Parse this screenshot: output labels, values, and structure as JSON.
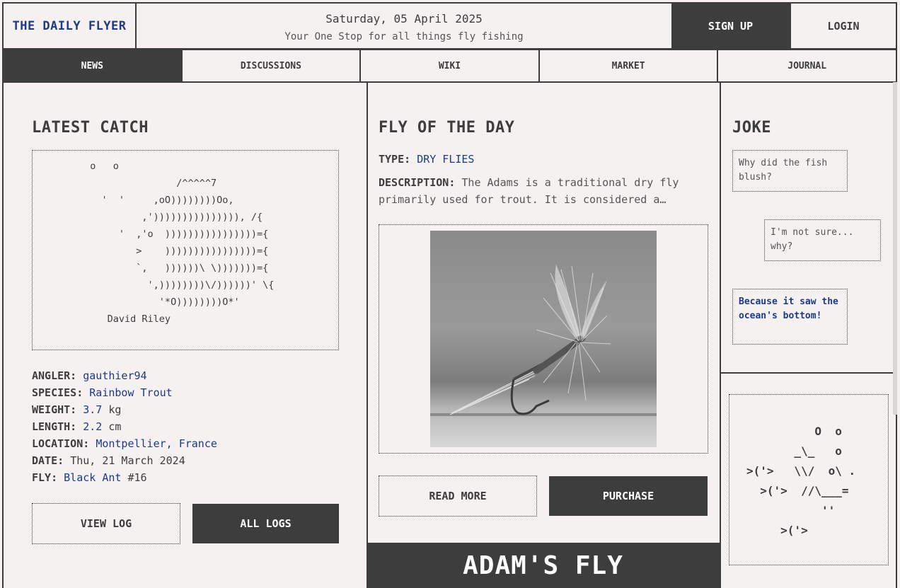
{
  "header": {
    "brand": "THE DAILY FLYER",
    "date": "Saturday, 05 April 2025",
    "tagline": "Your One Stop for all things fly fishing",
    "signup_label": "SIGN UP",
    "login_label": "LOGIN"
  },
  "nav": {
    "items": [
      {
        "label": "NEWS",
        "active": true
      },
      {
        "label": "DISCUSSIONS"
      },
      {
        "label": "WIKI"
      },
      {
        "label": "MARKET"
      },
      {
        "label": "JOURNAL"
      }
    ]
  },
  "latest_catch": {
    "title": "LATEST CATCH",
    "ascii_art": "          o   o\n                         /^^^^^7\n            '  '     ,oO))))))))Oo,\n                   ,'))))))))))))))), /{\n               '  ,'o  ))))))))))))))))={\n                  >    ))))))))))))))))={\n                  `,   ))))))\\ \\)))))))={\n                    ',))))))))\\/))))))' \\{\n                      '*O))))))))O*'\n             David Riley",
    "angler_label": "ANGLER:",
    "angler": "gauthier94",
    "species_label": "SPECIES:",
    "species": "Rainbow Trout",
    "weight_label": "WEIGHT:",
    "weight": "3.7",
    "weight_unit": "kg",
    "length_label": "LENGTH:",
    "length": "2.2",
    "length_unit": "cm",
    "location_label": "LOCATION:",
    "location": "Montpellier, France",
    "date_label": "DATE:",
    "date": "Thu, 21 March 2024",
    "fly_label": "FLY:",
    "fly": "Black Ant",
    "fly_size": "#16",
    "view_log_label": "VIEW LOG",
    "all_logs_label": "ALL LOGS"
  },
  "fly_of_day": {
    "title": "FLY OF THE DAY",
    "type_label": "TYPE:",
    "type": "DRY FLIES",
    "description_label": "DESCRIPTION:",
    "description": "The Adams is a traditional dry fly primarily used for trout. It is considered a…",
    "read_more_label": "READ MORE",
    "purchase_label": "PURCHASE",
    "fly_name": "ADAM'S FLY"
  },
  "joke": {
    "title": "JOKE",
    "q": "Why did the fish blush?",
    "r": "I'm not sure... why?",
    "a": "Because it saw the ocean's bottom!"
  },
  "fish_ascii": "          O  o\n       _\\_   o\n>('>   \\\\/  o\\ .\n  >('>  //\\___=\n           ''\n     >('>",
  "colors": {
    "dark": "#3d3d3d",
    "accent_blue": "#1f3a82",
    "background": "#f4f1f0"
  }
}
